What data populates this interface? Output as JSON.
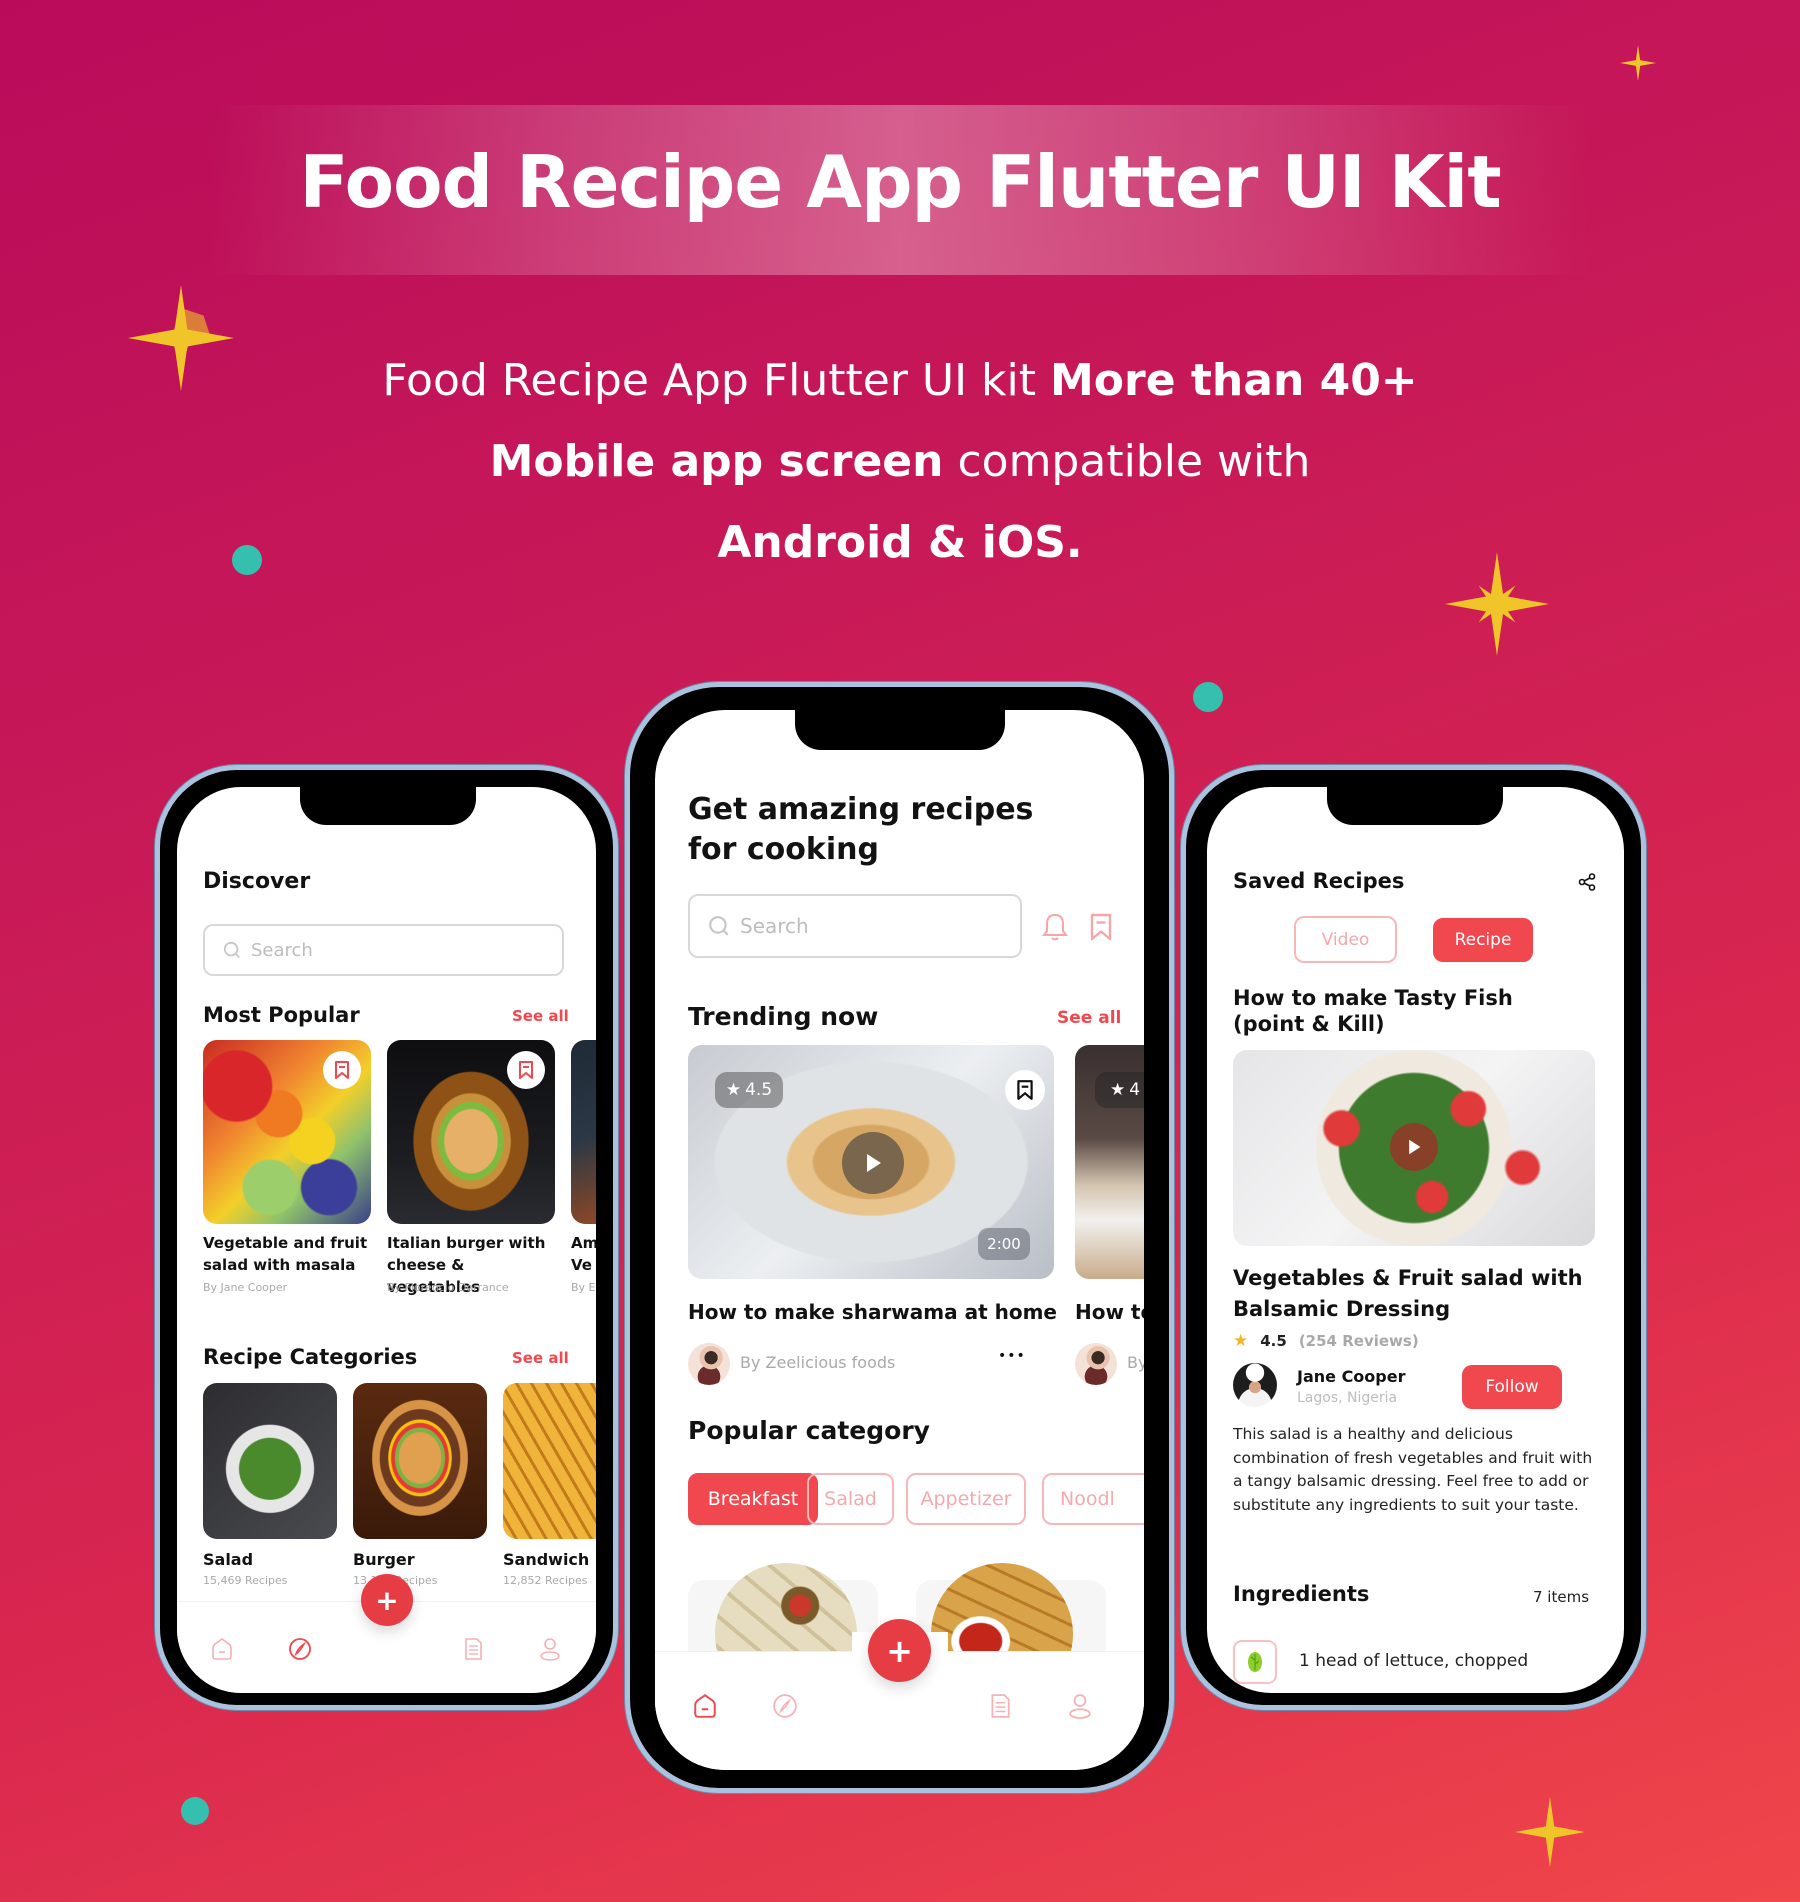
{
  "hero": {
    "title": "Food Recipe App Flutter UI Kit",
    "subtitle_line1_regular": "Food Recipe App Flutter UI kit ",
    "subtitle_line1_bold": "More than 40+",
    "subtitle_line2_bold": "Mobile app screen",
    "subtitle_line2_regular": " compatible with",
    "subtitle_line3_bold": "Android & iOS."
  },
  "colors": {
    "accent": "#f1474e",
    "fab": "#e63d45",
    "star": "#f5b42a",
    "teal_dot": "#35bfae",
    "sparkle": "#f0c52a"
  },
  "discover_screen": {
    "title": "Discover",
    "search_placeholder": "Search",
    "most_popular": {
      "heading": "Most Popular",
      "see_all": "See all",
      "items": [
        {
          "title": "Vegetable and fruit salad with masala",
          "author": "By Jane Cooper",
          "icon": "bookmark-icon"
        },
        {
          "title": "Italian burger with cheese & vegetables",
          "author": "By Florencio Dorrance",
          "icon": "bookmark-icon"
        },
        {
          "title": "Am Ve",
          "author": "By E"
        }
      ]
    },
    "categories": {
      "heading": "Recipe Categories",
      "see_all": "See all",
      "items": [
        {
          "name": "Salad",
          "count": "15,469 Recipes"
        },
        {
          "name": "Burger",
          "count": "13,127 Recipes"
        },
        {
          "name": "Sandwich",
          "count": "12,852 Recipes"
        }
      ]
    },
    "nav": {
      "fab": "+",
      "items": [
        "home-icon",
        "compass-icon",
        "document-icon",
        "profile-icon"
      ],
      "active": "compass-icon"
    }
  },
  "home_screen": {
    "title_line1": "Get amazing recipes",
    "title_line2": "for cooking",
    "search_placeholder": "Search",
    "trending": {
      "heading": "Trending now",
      "see_all": "See all",
      "items": [
        {
          "title": "How to make sharwama at home",
          "author": "By Zeelicious foods",
          "rating": "4.5",
          "duration": "2:00",
          "more": "•••"
        },
        {
          "title": "How to",
          "author": "By",
          "rating": "4"
        }
      ]
    },
    "popular_category": {
      "heading": "Popular category",
      "chips": [
        {
          "label": "Breakfast",
          "selected": true
        },
        {
          "label": "Salad",
          "selected": false
        },
        {
          "label": "Appetizer",
          "selected": false
        },
        {
          "label": "Noodl",
          "selected": false
        }
      ]
    },
    "nav": {
      "fab": "+",
      "items": [
        "home-icon",
        "compass-icon",
        "document-icon",
        "profile-icon"
      ],
      "active": "home-icon"
    }
  },
  "saved_screen": {
    "title": "Saved Recipes",
    "tabs": [
      {
        "label": "Video",
        "selected": false
      },
      {
        "label": "Recipe",
        "selected": true
      }
    ],
    "video_title_line1": "How to make Tasty Fish",
    "video_title_line2": "(point & Kill)",
    "recipe_title_line1": "Vegetables & Fruit salad with",
    "recipe_title_line2": "Balsamic Dressing",
    "rating": "4.5",
    "reviews": "(254 Reviews)",
    "chef": {
      "name": "Jane Cooper",
      "location": "Lagos, Nigeria",
      "follow": "Follow"
    },
    "description": "This salad is a healthy and delicious combination of fresh vegetables and fruit with a tangy balsamic dressing. Feel free to add or substitute any ingredients to suit your taste.",
    "ingredients": {
      "heading": "Ingredients",
      "count": "7 items",
      "items": [
        {
          "label": "1 head of lettuce, chopped",
          "icon": "lettuce-icon"
        }
      ]
    }
  }
}
